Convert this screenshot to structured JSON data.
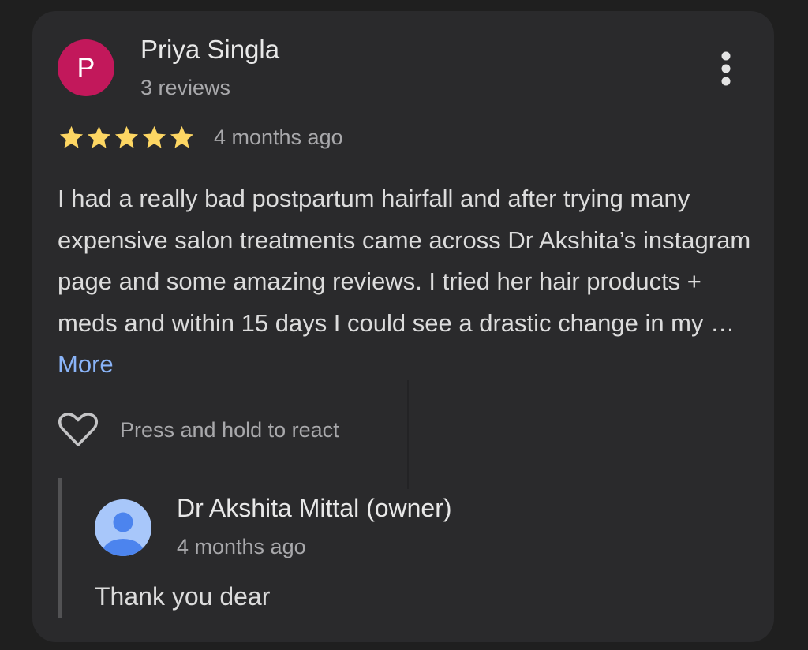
{
  "review": {
    "author": {
      "initial": "P",
      "name": "Priya Singla",
      "reviews_count": "3 reviews",
      "avatar_color": "#c2185b"
    },
    "rating": 5,
    "max_rating": 5,
    "star_color": "#fdd663",
    "date": "4 months ago",
    "text": "I had a really bad postpartum hairfall and after trying many expensive salon treatments came across Dr Akshita’s instagram page and some amazing reviews. I tried her hair products + meds and within 15 days I could see a drastic change in my …",
    "more_label": "More",
    "link_color": "#8ab4f8",
    "react_label": "Press and hold to react",
    "menu_icon": "more-vert-icon",
    "react_icon": "heart-outline-icon"
  },
  "owner_reply": {
    "name": "Dr Akshita Mittal (owner)",
    "date": "4 months ago",
    "text": "Thank you dear",
    "avatar_icon": "person-icon",
    "avatar_color": "#a8c7fa"
  }
}
